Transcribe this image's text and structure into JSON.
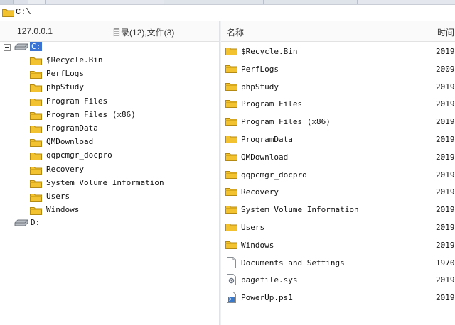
{
  "path": "C:\\",
  "left_header": {
    "host": "127.0.0.1",
    "summary": "目录(12),文件(3)"
  },
  "right_header": {
    "name_col": "名称",
    "time_col": "时间"
  },
  "tree": {
    "drive_c": "C:",
    "children": [
      "$Recycle.Bin",
      "PerfLogs",
      "phpStudy",
      "Program Files",
      "Program Files (x86)",
      "ProgramData",
      "QMDownload",
      "qqpcmgr_docpro",
      "Recovery",
      "System Volume Information",
      "Users",
      "Windows"
    ],
    "drive_d": "D:"
  },
  "files": [
    {
      "name": "$Recycle.Bin",
      "date": "2019",
      "icon": "folder-icon"
    },
    {
      "name": "PerfLogs",
      "date": "2009",
      "icon": "folder-icon"
    },
    {
      "name": "phpStudy",
      "date": "2019",
      "icon": "folder-icon"
    },
    {
      "name": "Program Files",
      "date": "2019",
      "icon": "folder-icon"
    },
    {
      "name": "Program Files (x86)",
      "date": "2019",
      "icon": "folder-icon"
    },
    {
      "name": "ProgramData",
      "date": "2019",
      "icon": "folder-icon"
    },
    {
      "name": "QMDownload",
      "date": "2019",
      "icon": "folder-icon"
    },
    {
      "name": "qqpcmgr_docpro",
      "date": "2019",
      "icon": "folder-icon"
    },
    {
      "name": "Recovery",
      "date": "2019",
      "icon": "folder-icon"
    },
    {
      "name": "System Volume Information",
      "date": "2019",
      "icon": "folder-icon"
    },
    {
      "name": "Users",
      "date": "2019",
      "icon": "folder-icon"
    },
    {
      "name": "Windows",
      "date": "2019",
      "icon": "folder-icon"
    },
    {
      "name": "Documents and Settings",
      "date": "1970",
      "icon": "blank-file-icon"
    },
    {
      "name": "pagefile.sys",
      "date": "2019",
      "icon": "system-file-icon"
    },
    {
      "name": "PowerUp.ps1",
      "date": "2019",
      "icon": "script-file-icon"
    }
  ],
  "colors": {
    "folder": "#f2c230",
    "selection": "#3a73d1"
  }
}
